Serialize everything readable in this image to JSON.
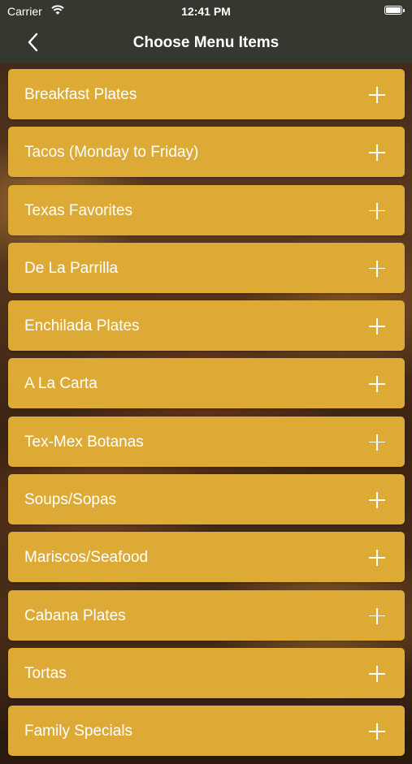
{
  "status_bar": {
    "carrier": "Carrier",
    "time": "12:41 PM"
  },
  "nav": {
    "title": "Choose Menu Items",
    "back_icon": "chevron-left-icon"
  },
  "theme": {
    "accent": "#dcaa35",
    "nav_background": "#34382f",
    "text": "#ffffff"
  },
  "menu_items": [
    {
      "label": "Breakfast Plates"
    },
    {
      "label": "Tacos (Monday to Friday)"
    },
    {
      "label": "Texas Favorites"
    },
    {
      "label": "De La Parrilla"
    },
    {
      "label": "Enchilada Plates"
    },
    {
      "label": "A La Carta"
    },
    {
      "label": "Tex-Mex Botanas"
    },
    {
      "label": "Soups/Sopas"
    },
    {
      "label": "Mariscos/Seafood"
    },
    {
      "label": "Cabana Plates"
    },
    {
      "label": "Tortas"
    },
    {
      "label": "Family Specials"
    }
  ]
}
